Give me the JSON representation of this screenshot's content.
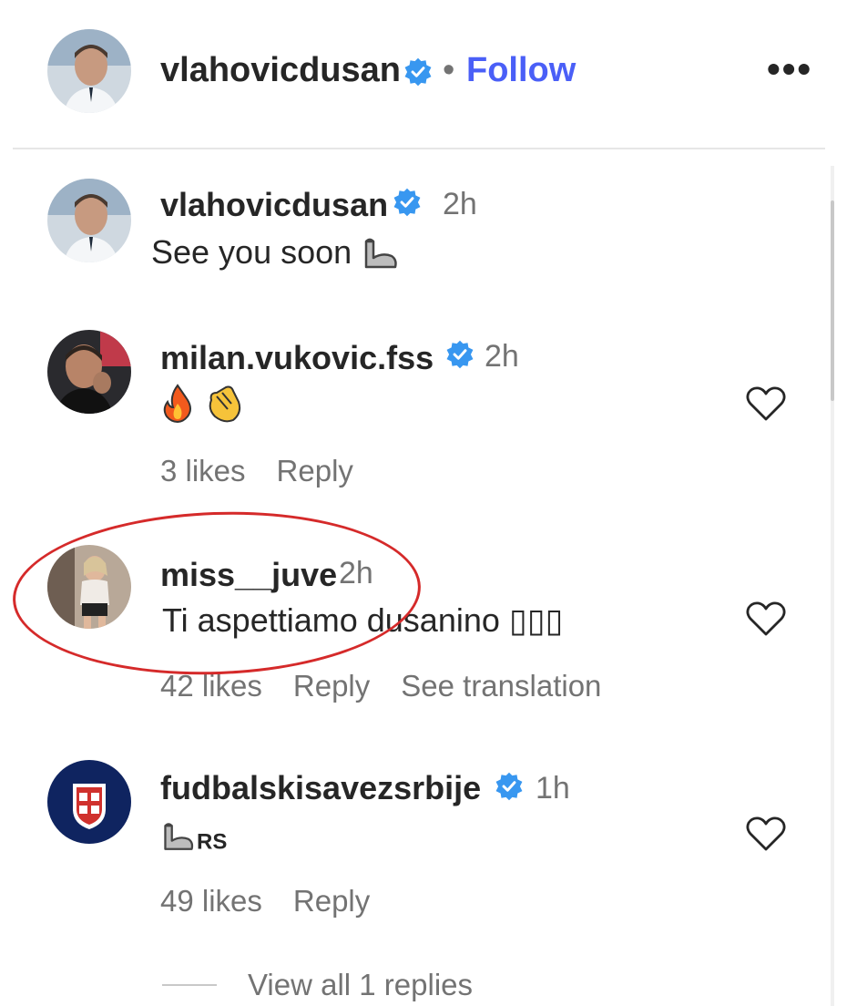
{
  "post": {
    "author": "vlahovicdusan",
    "separator": "•",
    "follow_label": "Follow",
    "more_label": "•••"
  },
  "caption": {
    "username": "vlahovicdusan",
    "time": "2h",
    "text": "See you soon",
    "emoji": "flexed-biceps"
  },
  "comments": [
    {
      "username": "milan.vukovic.fss",
      "verified": true,
      "time": "2h",
      "text": "",
      "emojis": [
        "fire",
        "clapping-hands"
      ],
      "likes": "3 likes",
      "reply": "Reply"
    },
    {
      "username": "miss__juve",
      "verified": false,
      "time": "2h",
      "text": "Ti aspettiamo dusanino ▯▯▯",
      "likes": "42 likes",
      "reply": "Reply",
      "translation": "See translation"
    },
    {
      "username": "fudbalskisavezsrbije",
      "verified": true,
      "time": "1h",
      "text": "RS",
      "emojis": [
        "flexed-biceps"
      ],
      "likes": "49 likes",
      "reply": "Reply"
    }
  ],
  "view_replies": "View all 1 replies",
  "colors": {
    "link": "#4a5ff7",
    "verified": "#3897f0",
    "highlight": "#d52a2a",
    "muted": "#737373"
  }
}
